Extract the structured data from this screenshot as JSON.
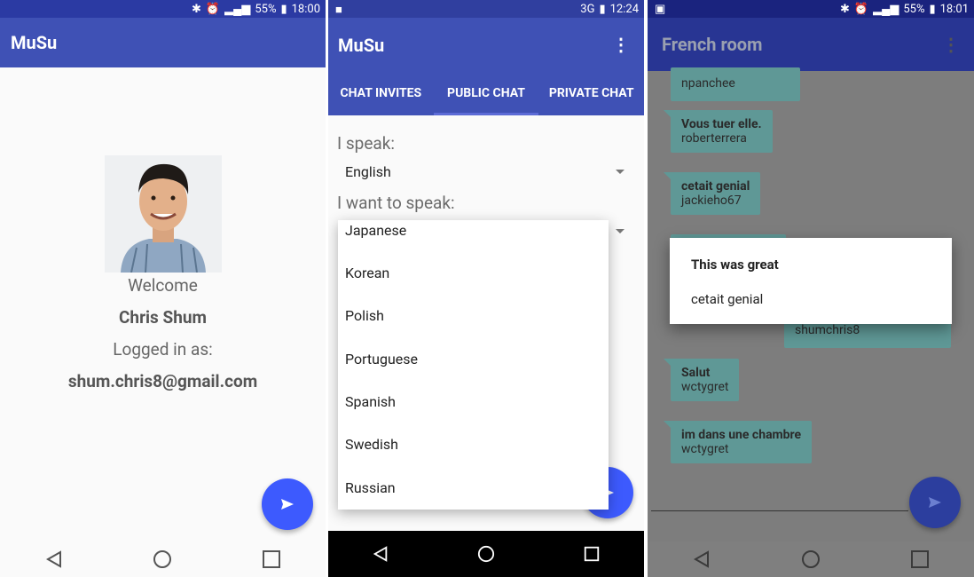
{
  "screen1": {
    "status": {
      "battery": "55%",
      "time": "18:00"
    },
    "app_title": "MuSu",
    "welcome": "Welcome",
    "name": "Chris Shum",
    "logged_in_label": "Logged in as:",
    "email": "shum.chris8@gmail.com"
  },
  "screen2": {
    "status": {
      "network": "3G",
      "time": "12:24"
    },
    "app_title": "MuSu",
    "tabs": [
      "CHAT INVITES",
      "PUBLIC CHAT",
      "PRIVATE CHAT"
    ],
    "active_tab": "PUBLIC CHAT",
    "i_speak_label": "I speak:",
    "i_speak_value": "English",
    "want_label": "I want to speak:",
    "languages": [
      "Japanese",
      "Korean",
      "Polish",
      "Portuguese",
      "Spanish",
      "Swedish",
      "Russian"
    ]
  },
  "screen3": {
    "status": {
      "battery": "55%",
      "time": "18:01"
    },
    "room_title": "French room",
    "messages": [
      {
        "text": "",
        "user": "npanchee"
      },
      {
        "text": "Vous tuer elle.",
        "user": "roberterrera"
      },
      {
        "text": "cetait genial",
        "user": "jackieho67"
      },
      {
        "text": "",
        "user": "shumchris8"
      },
      {
        "text": "Salut",
        "user": "wctygret"
      },
      {
        "text": "im dans une chambre",
        "user": "wctygret"
      }
    ],
    "dialog": {
      "title": "This was great",
      "body": "cetait genial"
    }
  },
  "colors": {
    "primary": "#3f51b5",
    "fab": "#3d5afe",
    "bubble": "#5f9896"
  }
}
